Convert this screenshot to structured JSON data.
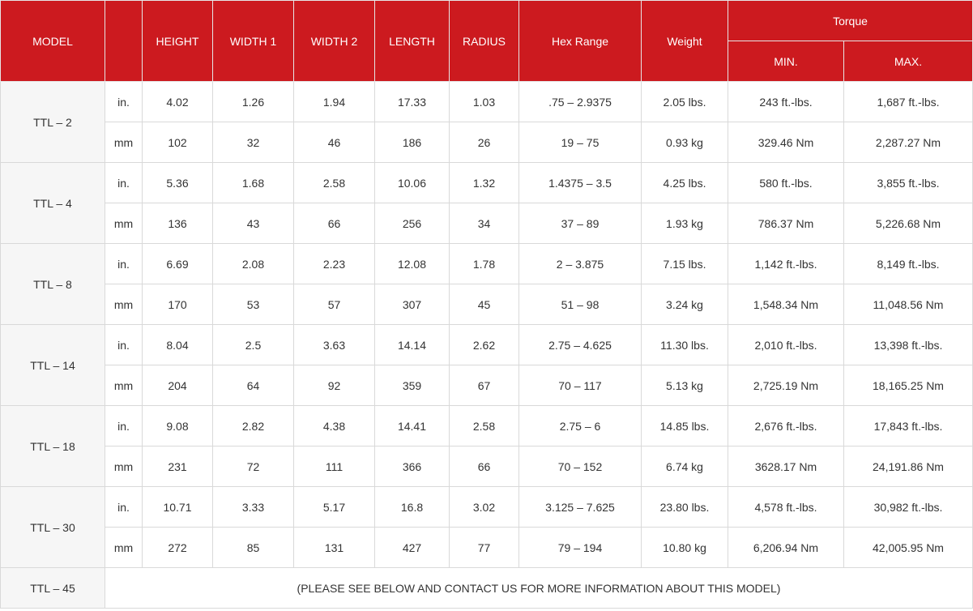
{
  "headers": {
    "model": "MODEL",
    "unit": "",
    "height": "HEIGHT",
    "width1": "WIDTH 1",
    "width2": "WIDTH 2",
    "length": "LENGTH",
    "radius": "RADIUS",
    "hex_range": "Hex Range",
    "weight": "Weight",
    "torque": "Torque",
    "torque_min": "MIN.",
    "torque_max": "MAX."
  },
  "rows": [
    {
      "model": "TTL – 2",
      "in": {
        "unit": "in.",
        "height": "4.02",
        "width1": "1.26",
        "width2": "1.94",
        "length": "17.33",
        "radius": "1.03",
        "hex": ".75 – 2.9375",
        "weight": "2.05 lbs.",
        "min": "243 ft.-lbs.",
        "max": "1,687 ft.-lbs."
      },
      "mm": {
        "unit": "mm",
        "height": "102",
        "width1": "32",
        "width2": "46",
        "length": "186",
        "radius": "26",
        "hex": "19 – 75",
        "weight": "0.93 kg",
        "min": "329.46 Nm",
        "max": "2,287.27 Nm"
      }
    },
    {
      "model": "TTL – 4",
      "in": {
        "unit": "in.",
        "height": "5.36",
        "width1": "1.68",
        "width2": "2.58",
        "length": "10.06",
        "radius": "1.32",
        "hex": "1.4375 – 3.5",
        "weight": "4.25 lbs.",
        "min": "580 ft.-lbs.",
        "max": "3,855 ft.-lbs."
      },
      "mm": {
        "unit": "mm",
        "height": "136",
        "width1": "43",
        "width2": "66",
        "length": "256",
        "radius": "34",
        "hex": "37 – 89",
        "weight": "1.93 kg",
        "min": "786.37 Nm",
        "max": "5,226.68 Nm"
      }
    },
    {
      "model": "TTL – 8",
      "in": {
        "unit": "in.",
        "height": "6.69",
        "width1": "2.08",
        "width2": "2.23",
        "length": "12.08",
        "radius": "1.78",
        "hex": "2 – 3.875",
        "weight": "7.15 lbs.",
        "min": "1,142 ft.-lbs.",
        "max": "8,149 ft.-lbs."
      },
      "mm": {
        "unit": "mm",
        "height": "170",
        "width1": "53",
        "width2": "57",
        "length": "307",
        "radius": "45",
        "hex": "51 – 98",
        "weight": "3.24 kg",
        "min": "1,548.34 Nm",
        "max": "11,048.56 Nm"
      }
    },
    {
      "model": "TTL – 14",
      "in": {
        "unit": "in.",
        "height": "8.04",
        "width1": "2.5",
        "width2": "3.63",
        "length": "14.14",
        "radius": "2.62",
        "hex": "2.75 – 4.625",
        "weight": "11.30 lbs.",
        "min": "2,010 ft.-lbs.",
        "max": "13,398 ft.-lbs."
      },
      "mm": {
        "unit": "mm",
        "height": "204",
        "width1": "64",
        "width2": "92",
        "length": "359",
        "radius": "67",
        "hex": "70 – 117",
        "weight": "5.13 kg",
        "min": "2,725.19 Nm",
        "max": "18,165.25 Nm"
      }
    },
    {
      "model": "TTL – 18",
      "in": {
        "unit": "in.",
        "height": "9.08",
        "width1": "2.82",
        "width2": "4.38",
        "length": "14.41",
        "radius": "2.58",
        "hex": "2.75 – 6",
        "weight": "14.85 lbs.",
        "min": "2,676 ft.-lbs.",
        "max": "17,843 ft.-lbs."
      },
      "mm": {
        "unit": "mm",
        "height": "231",
        "width1": "72",
        "width2": "111",
        "length": "366",
        "radius": "66",
        "hex": "70 – 152",
        "weight": "6.74 kg",
        "min": "3628.17 Nm",
        "max": "24,191.86 Nm"
      }
    },
    {
      "model": "TTL – 30",
      "in": {
        "unit": "in.",
        "height": "10.71",
        "width1": "3.33",
        "width2": "5.17",
        "length": "16.8",
        "radius": "3.02",
        "hex": "3.125 – 7.625",
        "weight": "23.80 lbs.",
        "min": "4,578 ft.-lbs.",
        "max": "30,982 ft.-lbs."
      },
      "mm": {
        "unit": "mm",
        "height": "272",
        "width1": "85",
        "width2": "131",
        "length": "427",
        "radius": "77",
        "hex": "79 – 194",
        "weight": "10.80 kg",
        "min": "6,206.94 Nm",
        "max": "42,005.95 Nm"
      }
    }
  ],
  "last_row": {
    "model": "TTL – 45",
    "note": "(PLEASE SEE BELOW AND CONTACT US FOR MORE INFORMATION ABOUT THIS MODEL)"
  }
}
